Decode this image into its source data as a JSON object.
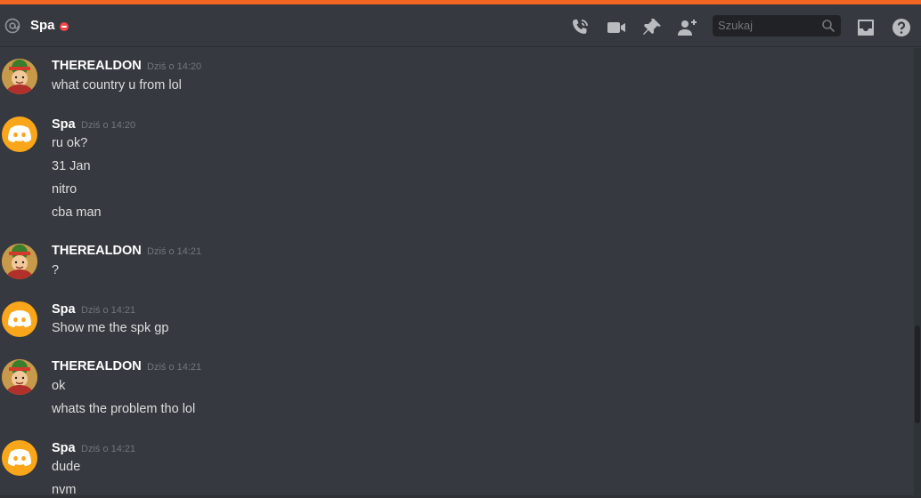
{
  "header": {
    "channel_name": "Spa",
    "search_placeholder": "Szukaj",
    "icons": [
      "at-icon",
      "dnd-status-icon",
      "voice-call-icon",
      "video-call-icon",
      "pin-icon",
      "add-friend-icon",
      "search-icon",
      "inbox-icon",
      "help-icon"
    ]
  },
  "colors": {
    "accent": "#f26522",
    "background": "#36393f",
    "header_bg": "#36393f",
    "search_bg": "#202225",
    "dnd_status": "#f04747",
    "spa_avatar": "#faa61a",
    "username": "#ffffff",
    "timestamp": "#72767d",
    "message_text": "#dcddde"
  },
  "messages": [
    {
      "author": "THEREALDON",
      "timestamp": "Dziś o 14:20",
      "lines": [
        "what country u from lol"
      ]
    },
    {
      "author": "Spa",
      "timestamp": "Dziś o 14:20",
      "lines": [
        "ru ok?",
        "31 Jan",
        "nitro",
        "cba man"
      ]
    },
    {
      "author": "THEREALDON",
      "timestamp": "Dziś o 14:21",
      "lines": [
        "?"
      ]
    },
    {
      "author": "Spa",
      "timestamp": "Dziś o 14:21",
      "lines": [
        "Show me the spk gp"
      ]
    },
    {
      "author": "THEREALDON",
      "timestamp": "Dziś o 14:21",
      "lines": [
        "ok",
        "whats the problem tho lol"
      ]
    },
    {
      "author": "Spa",
      "timestamp": "Dziś o 14:21",
      "lines": [
        "dude",
        "nvm"
      ]
    }
  ]
}
